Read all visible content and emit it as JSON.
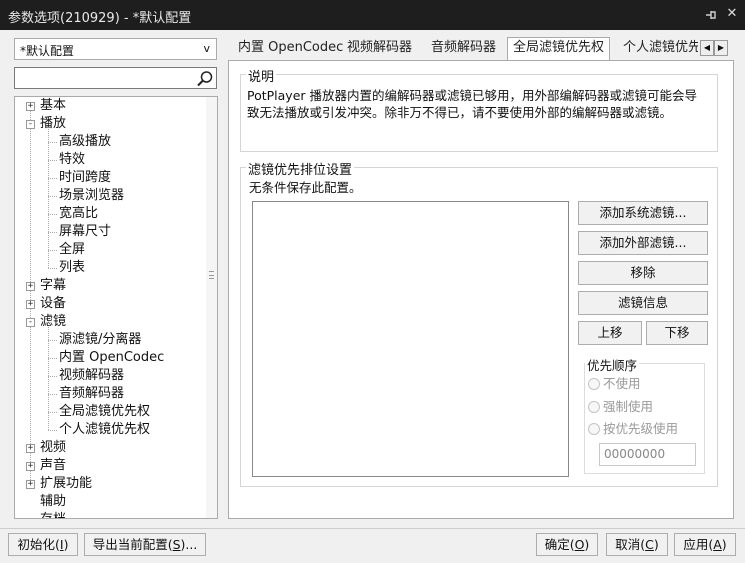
{
  "window": {
    "title": "参数选项(210929) - *默认配置",
    "pin_icon": "pin-icon",
    "close_icon": "close-icon"
  },
  "sidebar": {
    "profile_select": {
      "value": "*默认配置",
      "arrow": "v"
    },
    "search": {
      "value": "",
      "icon": "search-icon"
    },
    "tree": [
      {
        "label": "基本",
        "expander": "+"
      },
      {
        "label": "播放",
        "expander": "-"
      },
      {
        "label": "高级播放"
      },
      {
        "label": "特效"
      },
      {
        "label": "时间跨度"
      },
      {
        "label": "场景浏览器"
      },
      {
        "label": "宽高比"
      },
      {
        "label": "屏幕尺寸"
      },
      {
        "label": "全屏"
      },
      {
        "label": "列表"
      },
      {
        "label": "字幕",
        "expander": "+"
      },
      {
        "label": "设备",
        "expander": "+"
      },
      {
        "label": "滤镜",
        "expander": "-"
      },
      {
        "label": "源滤镜/分离器"
      },
      {
        "label": "内置 OpenCodec"
      },
      {
        "label": "视频解码器"
      },
      {
        "label": "音频解码器"
      },
      {
        "label": "全局滤镜优先权"
      },
      {
        "label": "个人滤镜优先权"
      },
      {
        "label": "视频",
        "expander": "+"
      },
      {
        "label": "声音",
        "expander": "+"
      },
      {
        "label": "扩展功能",
        "expander": "+"
      },
      {
        "label": "辅助"
      },
      {
        "label": "存档"
      }
    ]
  },
  "tabs": [
    {
      "label": "内置 OpenCodec"
    },
    {
      "label": "视频解码器"
    },
    {
      "label": "音频解码器"
    },
    {
      "label": "全局滤镜优先权",
      "active": true
    },
    {
      "label": "个人滤镜优先权"
    }
  ],
  "tab_scroll": {
    "left": "◀",
    "right": "▶"
  },
  "content": {
    "description": {
      "heading": "说明",
      "text_line1": "PotPlayer 播放器内置的编解码器或滤镜已够用，用外部编解码器或滤镜可能会导",
      "text_line2": "致无法播放或引发冲突。除非万不得已，请不要使用外部的编解码器或滤镜。"
    },
    "priority": {
      "heading": "滤镜优先排位设置",
      "note": "无条件保存此配置。",
      "buttons": {
        "add_system": "添加系统滤镜...",
        "add_external": "添加外部滤镜...",
        "remove": "移除",
        "filter_info": "滤镜信息",
        "move_up": "上移",
        "move_down": "下移"
      },
      "order": {
        "heading": "优先顺序",
        "options": [
          "不使用",
          "强制使用",
          "按优先级使用"
        ],
        "value": "00000000"
      }
    }
  },
  "footer": {
    "init": {
      "text": "初始化(",
      "key": "I",
      "end": ")"
    },
    "export": {
      "text": "导出当前配置(",
      "key": "S",
      "end": ")..."
    },
    "ok": {
      "text": "确定(",
      "key": "O",
      "end": ")"
    },
    "cancel": {
      "text": "取消(",
      "key": "C",
      "end": ")"
    },
    "apply": {
      "text": "应用(",
      "key": "A",
      "end": ")"
    }
  }
}
